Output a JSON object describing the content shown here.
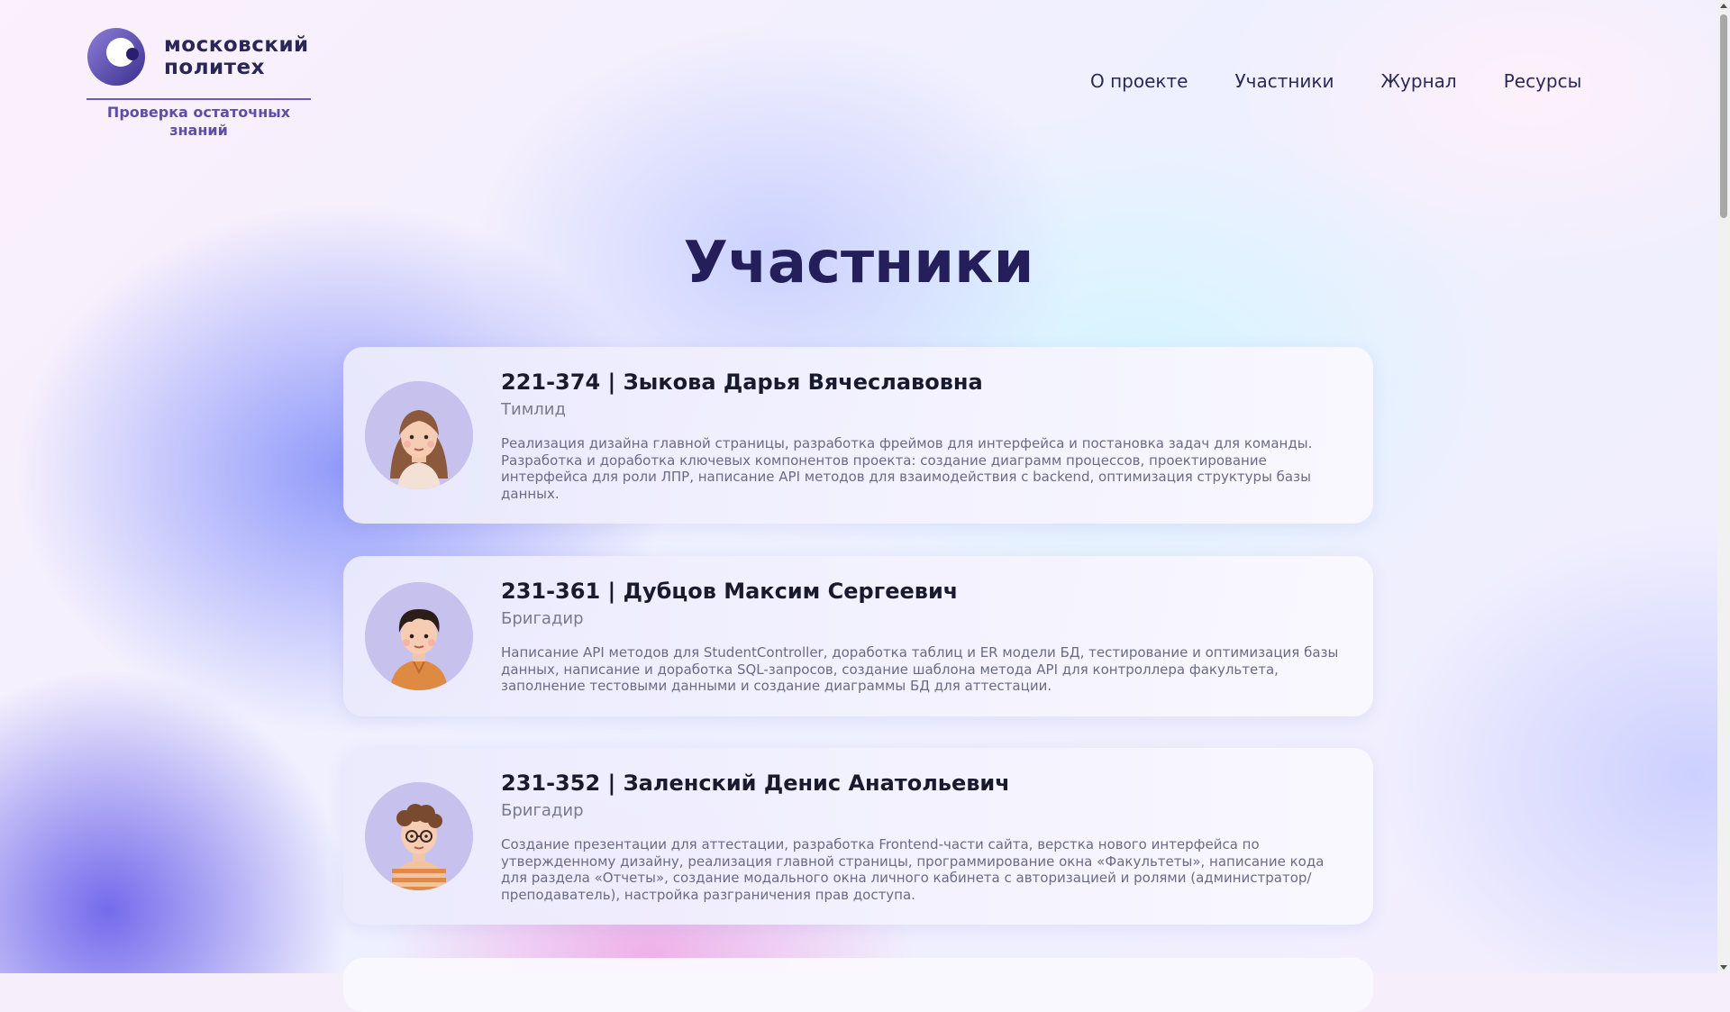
{
  "logo": {
    "text": "московский\nполитех",
    "subtitle": "Проверка остаточных знаний"
  },
  "nav": [
    "О проекте",
    "Участники",
    "Журнал",
    "Ресурсы"
  ],
  "page": {
    "title": "Участники"
  },
  "members": [
    {
      "title": "221-374 | Зыкова Дарья Вячеславовна",
      "role": "Тимлид",
      "description": "Реализация дизайна главной страницы, разработка фреймов для интерфейса и постановка задач для команды. Разработка и доработка ключевых компонентов проекта: создание диаграмм процессов, проектирование интерфейса для роли ЛПР, написание API методов для взаимодействия с backend, оптимизация структуры базы данных.",
      "avatar_icon": "girl-avatar-icon"
    },
    {
      "title": "231-361 | Дубцов Максим Сергеевич",
      "role": "Бригадир",
      "description": "Написание API методов для StudentController, доработка таблиц и ER модели БД, тестирование и оптимизация базы данных, написание и доработка SQL-запросов, создание шаблона метода API для контроллера факультета, заполнение тестовыми данными и создание диаграммы БД для аттестации.",
      "avatar_icon": "boy-avatar-icon"
    },
    {
      "title": "231-352 | Заленский Денис Анатольевич",
      "role": "Бригадир",
      "description": "Создание презентации для аттестации, разработка Frontend-части сайта, верстка нового интерфейса по утвержденному дизайну, реализация главной страницы, программирование окна «Факультеты», написание кода для раздела «Отчеты», создание модального окна личного кабинета с авторизацией и ролями (администратор/преподаватель), настройка разграничения прав доступа.",
      "avatar_icon": "curly-boy-avatar-icon"
    }
  ],
  "colors": {
    "title": "#241f5b",
    "nav": "#2b2958",
    "accent": "#6b5db6",
    "role": "#7a7a8c",
    "description": "#6b6b86"
  }
}
